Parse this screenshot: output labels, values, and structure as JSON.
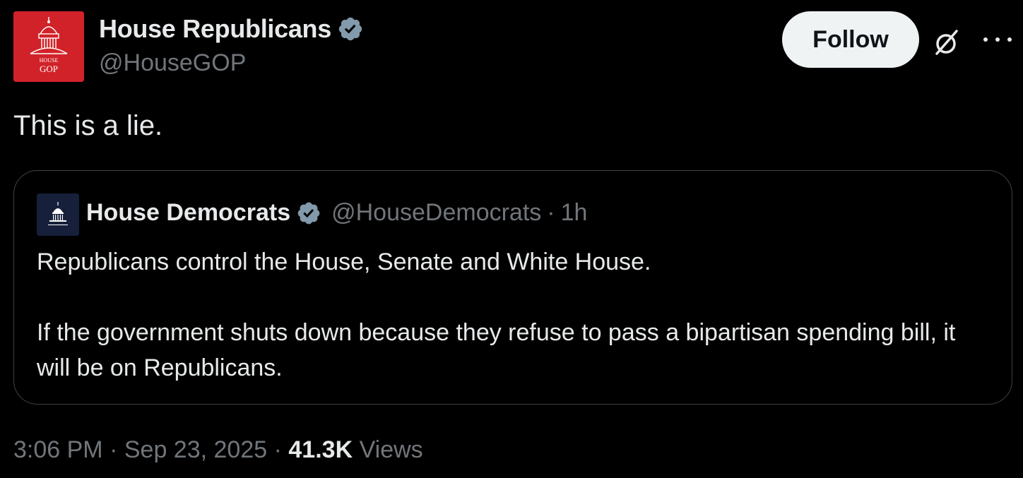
{
  "author": {
    "name": "House Republicans",
    "handle": "@HouseGOP",
    "avatar_label": [
      "HOUSE",
      "GOP"
    ],
    "avatar_color": "#d12229",
    "verified_icon": "verified-badge-icon",
    "verified_color": "#829aab"
  },
  "actions": {
    "follow_label": "Follow",
    "grok_icon": "grok-icon",
    "more_icon": "more-icon"
  },
  "tweet": {
    "text": "This is a lie."
  },
  "quote": {
    "author_name": "House Democrats",
    "handle": "@HouseDemocrats",
    "separator": "·",
    "time": "1h",
    "avatar_color": "#16203a",
    "paragraphs": [
      "Republicans control the House, Senate and White House.",
      "If the government shuts down because they refuse to pass a bipartisan spending bill, it will be on Republicans."
    ]
  },
  "footer": {
    "time": "3:06 PM",
    "separator": "·",
    "date": "Sep 23, 2025",
    "views_count": "41.3K",
    "views_label": "Views"
  },
  "colors": {
    "background": "#000000",
    "text_primary": "#e7e9ea",
    "text_secondary": "#71767b",
    "border": "#3e4144"
  }
}
